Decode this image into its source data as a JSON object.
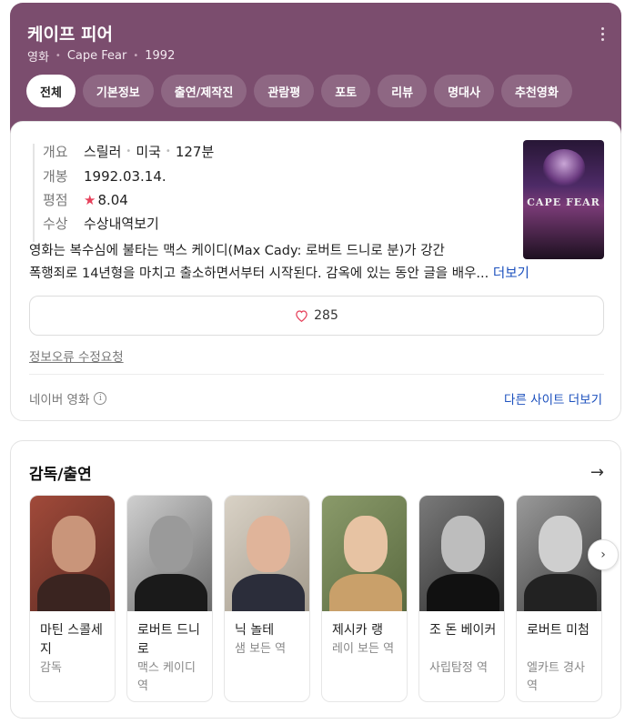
{
  "header": {
    "title": "케이프 피어",
    "genre_word": "영화",
    "original_title": "Cape Fear",
    "year": "1992",
    "background_color": "#7b4d6e",
    "tabs": [
      {
        "label": "전체",
        "active": true
      },
      {
        "label": "기본정보"
      },
      {
        "label": "출연/제작진"
      },
      {
        "label": "관람평"
      },
      {
        "label": "포토"
      },
      {
        "label": "리뷰"
      },
      {
        "label": "명대사"
      },
      {
        "label": "추천영화"
      }
    ]
  },
  "info": {
    "overview_label": "개요",
    "genre": "스릴러",
    "country": "미국",
    "runtime": "127분",
    "release_label": "개봉",
    "release_date": "1992.03.14.",
    "rating_label": "평점",
    "rating": "8.04",
    "award_label": "수상",
    "award_link": "수상내역보기",
    "poster_text": "CAPE FEAR",
    "synopsis_line1": "영화는 복수심에 불타는 맥스 케이디(Max Cady: 로버트 드니로 분)가 강간",
    "synopsis_line2": "폭행죄로 14년형을 마치고 출소하면서부터 시작된다. 감옥에 있는 동안 글을 배우...",
    "more_label": "더보기",
    "like_count": "285",
    "correction_label": "정보오류 수정요청",
    "source_label": "네이버 영화",
    "other_sites_label": "다른 사이트 더보기"
  },
  "cast": {
    "title": "감독/출연",
    "people": [
      {
        "name": "마틴 스콜세지",
        "role": "감독",
        "tone": "color"
      },
      {
        "name": "로버트 드니로",
        "role": "맥스 케이디 역",
        "tone": "bw"
      },
      {
        "name": "닉 놀테",
        "role": "샘 보든 역",
        "tone": "color"
      },
      {
        "name": "제시카 랭",
        "role": "레이 보든 역",
        "tone": "color"
      },
      {
        "name": "조 돈 베이커",
        "role": "사립탐정 역",
        "tone": "bw"
      },
      {
        "name": "로버트 미첨",
        "role": "엘카트 경사 역",
        "tone": "bw"
      }
    ]
  }
}
